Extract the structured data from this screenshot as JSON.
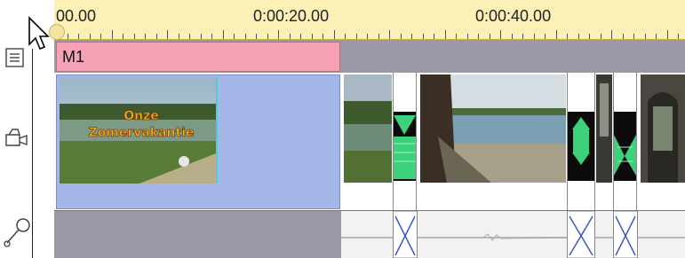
{
  "ruler": {
    "labels": [
      "00.00",
      "0:00:20.00",
      "0:00:40.00"
    ]
  },
  "marker": {
    "label": "M1"
  },
  "clip": {
    "title_text": "Onze Zomervakantie"
  },
  "icons": {
    "cursor": "arrow-cursor-icon",
    "title_track": "title-track-icon",
    "video_track": "video-track-icon",
    "audio_track": "microphone-icon"
  },
  "colors": {
    "ruler_bg": "#fbf0b5",
    "marker_bg": "#f7a1b7",
    "selected_clip_bg": "#a5b6e8",
    "track_bg": "#9a9aa6",
    "transition_green": "#3cd27c"
  }
}
